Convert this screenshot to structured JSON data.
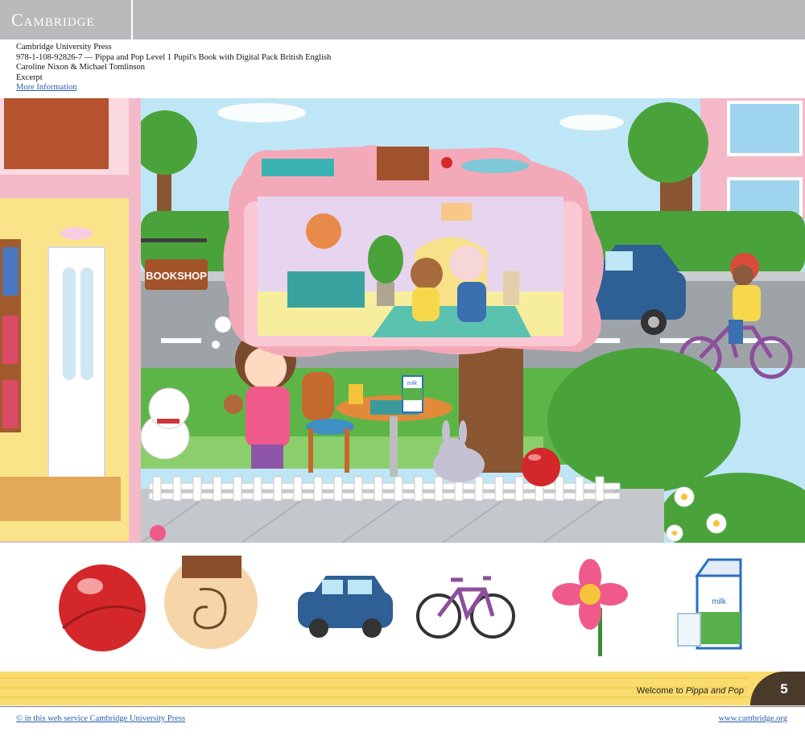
{
  "header": {
    "logo_text": "Cambridge"
  },
  "meta": {
    "publisher": "Cambridge University Press",
    "title_line": "978-1-108-92826-7 — Pippa and Pop Level 1 Pupil's Book with Digital Pack British English",
    "authors": "Caroline Nixon & Michael Tomlinson",
    "excerpt": "Excerpt",
    "more_info": "More Information"
  },
  "illustration": {
    "shop_sign": "BOOKSHOP",
    "carton_label": "milk",
    "icons": [
      "house-icon",
      "tree-icon",
      "car-icon",
      "bicycle-icon",
      "girl-icon",
      "cat-icon",
      "rabbit-icon",
      "ball-icon",
      "table-icon",
      "chair-icon",
      "fence-icon",
      "thought-bubble-icon",
      "mouse-icon",
      "flower-icon"
    ]
  },
  "vocab_items": [
    {
      "name": "ball",
      "icon": "ball-icon"
    },
    {
      "name": "ear",
      "icon": "ear-icon"
    },
    {
      "name": "car",
      "icon": "car-icon"
    },
    {
      "name": "bicycle",
      "icon": "bicycle-icon"
    },
    {
      "name": "flower",
      "icon": "flower-icon"
    },
    {
      "name": "milk",
      "icon": "milk-icon"
    }
  ],
  "band": {
    "welcome_prefix": "Welcome to ",
    "book_title": "Pippa and Pop",
    "page_number": "5"
  },
  "footer": {
    "copyright": "© in this web service Cambridge University Press",
    "website": "www.cambridge.org"
  },
  "colors": {
    "header_grey": "#b9babc",
    "link_blue": "#2a5db0",
    "band_yellow": "#f9dc6e",
    "page_tab_brown": "#4a3a2a"
  }
}
